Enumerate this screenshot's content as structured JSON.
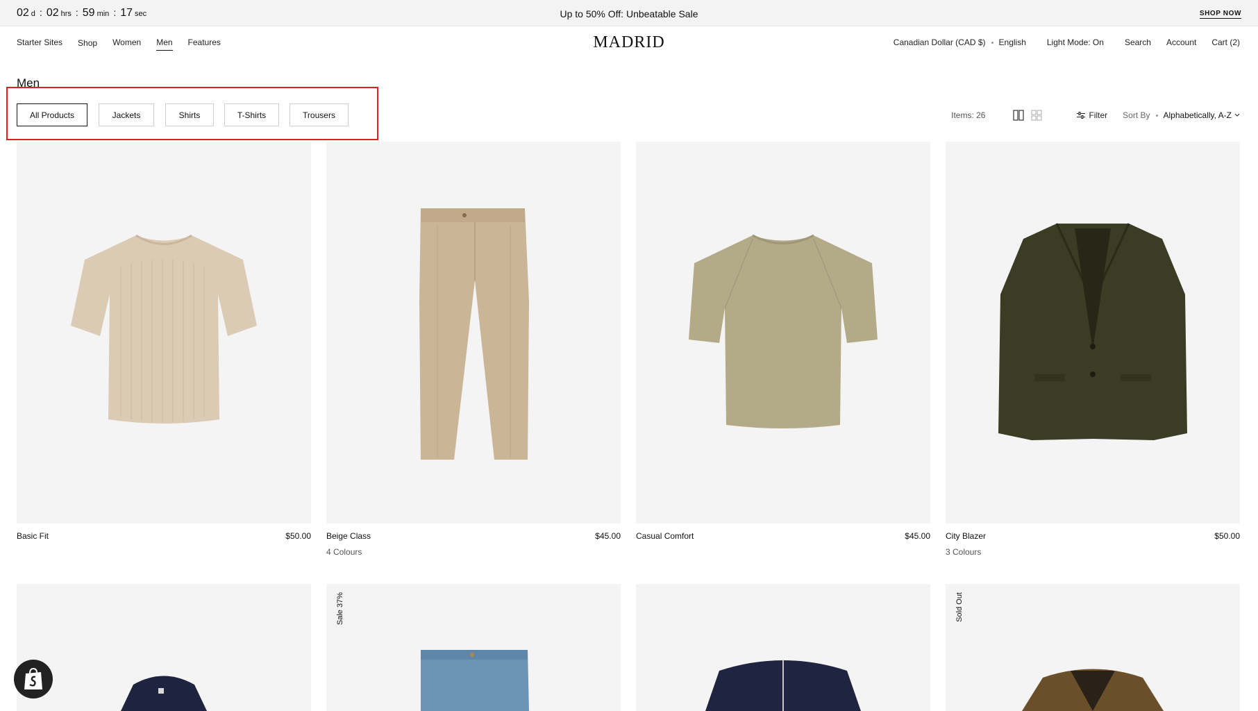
{
  "announcement": {
    "countdown": [
      {
        "value": "02",
        "unit": "d"
      },
      {
        "value": "02",
        "unit": "hrs"
      },
      {
        "value": "59",
        "unit": "min"
      },
      {
        "value": "17",
        "unit": "sec"
      }
    ],
    "separator": ":",
    "text": "Up to 50% Off: Unbeatable Sale",
    "cta": "SHOP NOW"
  },
  "header": {
    "nav": [
      "Starter Sites",
      "Shop",
      "Women",
      "Men",
      "Features"
    ],
    "logo": "MADRID",
    "currency": "Canadian Dollar (CAD $)",
    "language": "English",
    "light_mode": "Light Mode: On",
    "search": "Search",
    "account": "Account",
    "cart": "Cart (2)"
  },
  "collection": {
    "title": "Men",
    "filters": [
      "All Products",
      "Jackets",
      "Shirts",
      "T-Shirts",
      "Trousers"
    ],
    "items_count": "Items: 26",
    "filter_label": "Filter",
    "sort_label": "Sort By",
    "sort_value": "Alphabetically, A-Z"
  },
  "products": [
    {
      "name": "Basic Fit",
      "price": "$50.00",
      "colours": "",
      "badge": ""
    },
    {
      "name": "Beige Class",
      "price": "$45.00",
      "colours": "4 Colours",
      "badge": ""
    },
    {
      "name": "Casual Comfort",
      "price": "$45.00",
      "colours": "",
      "badge": ""
    },
    {
      "name": "City Blazer",
      "price": "$50.00",
      "colours": "3 Colours",
      "badge": ""
    },
    {
      "name": "",
      "price": "",
      "colours": "",
      "badge": ""
    },
    {
      "name": "",
      "price": "",
      "colours": "",
      "badge": "Sale 37%"
    },
    {
      "name": "",
      "price": "",
      "colours": "",
      "badge": ""
    },
    {
      "name": "",
      "price": "",
      "colours": "",
      "badge": "Sold Out"
    }
  ],
  "colors": {
    "highlight": "#e31b23",
    "card_bg": "#f4f4f4",
    "announce_bg": "#f3f3f3"
  }
}
